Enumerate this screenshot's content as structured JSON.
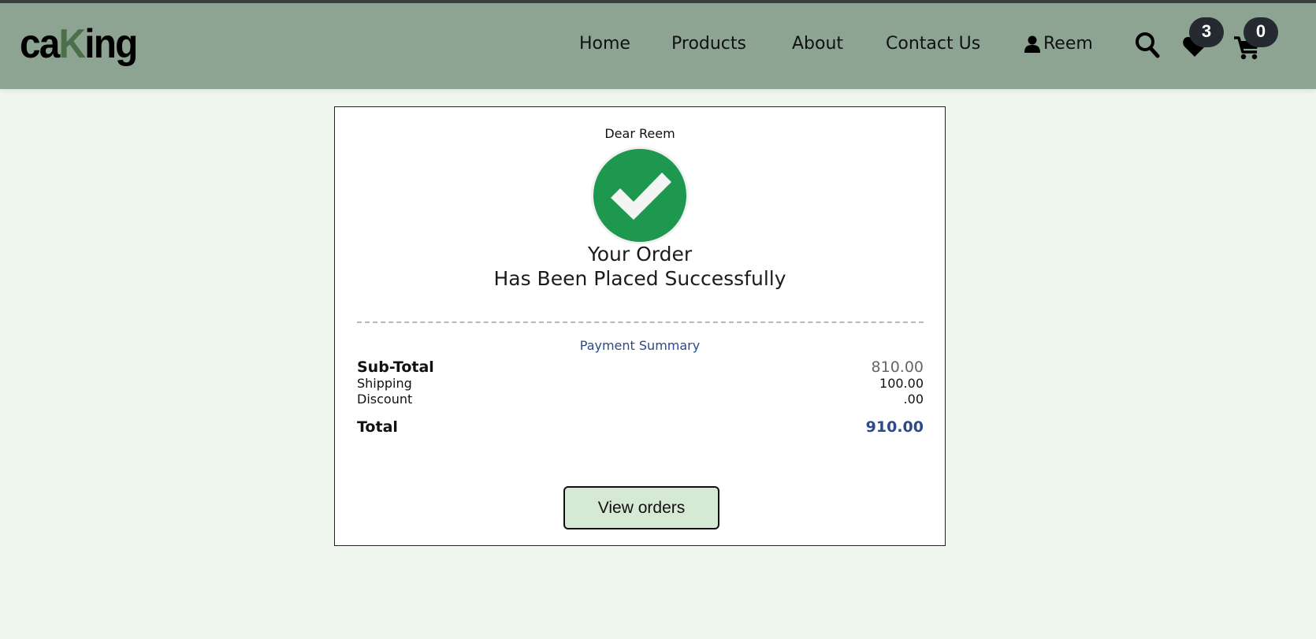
{
  "header": {
    "logo": {
      "part1": "ca",
      "part2": "K",
      "part3": "ing"
    },
    "nav": {
      "home": "Home",
      "products": "Products",
      "about": "About",
      "contact": "Contact Us",
      "user": "Reem"
    },
    "icons": {
      "user": "user-icon",
      "search": "search-icon",
      "wishlist": "heart-icon",
      "cart": "cart-icon"
    },
    "wishlist_count": "3",
    "cart_count": "0"
  },
  "order": {
    "greeting": "Dear Reem",
    "title_line1": "Your Order",
    "title_line2": "Has Been Placed Successfully",
    "payment_summary_title": "Payment Summary",
    "subtotal_label": "Sub-Total",
    "subtotal_value": "810.00",
    "shipping_label": "Shipping",
    "shipping_value": "100.00",
    "discount_label": "Discount",
    "discount_value": ".00",
    "total_label": "Total",
    "total_value": "910.00",
    "view_orders_label": "View orders"
  },
  "colors": {
    "header_bg": "#8da493",
    "page_bg": "#f0f7ee",
    "success_green": "#1e974f",
    "accent_blue": "#2c4a86",
    "badge_bg": "#252a30",
    "button_bg": "#d6e9d5"
  }
}
